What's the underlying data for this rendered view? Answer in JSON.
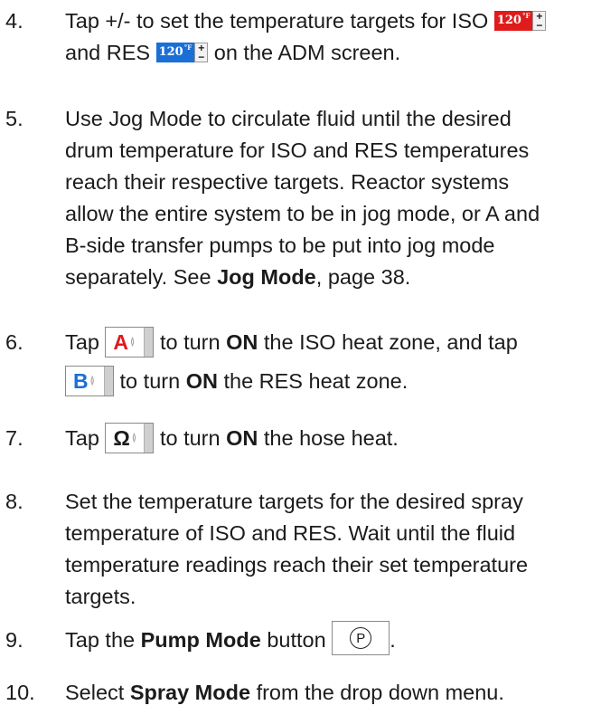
{
  "steps": [
    {
      "number": "4.",
      "text_a": "Tap +/- to set the temperature targets for ISO",
      "text_b": "and RES",
      "text_c": "on the ADM screen."
    },
    {
      "number": "5.",
      "lines": [
        "Use Jog Mode to circulate fluid until the desired",
        "drum temperature for ISO and RES temperatures",
        "reach their respective targets. Reactor systems",
        "allow the entire system to be in jog mode, or A and",
        "B-side transfer pumps to be put into jog mode"
      ],
      "last_pre": "separately. See ",
      "last_bold": "Jog Mode",
      "last_post": ", page 38."
    },
    {
      "number": "6.",
      "a1": "Tap",
      "a2": "to turn ",
      "a_on": "ON",
      "a3": " the ISO heat zone, and tap",
      "b2": "to turn ",
      "b_on": "ON",
      "b3": " the RES heat zone."
    },
    {
      "number": "7.",
      "a1": "Tap",
      "a2": "to turn ",
      "a_on": "ON",
      "a3": " the hose heat."
    },
    {
      "number": "8.",
      "lines": [
        "Set the temperature targets for the desired spray",
        "temperature of ISO and RES. Wait until the fluid",
        "temperature readings reach their set temperature",
        "targets."
      ]
    },
    {
      "number": "9.",
      "pre": "Tap the ",
      "bold": "Pump Mode",
      "post": " button",
      "end": "."
    },
    {
      "number": "10.",
      "pre": "Select ",
      "bold": "Spray Mode",
      "post": " from the drop down menu."
    }
  ],
  "widgets": {
    "iso_temp": {
      "value": "120",
      "unit": "°F",
      "plus": "+",
      "minus": "−",
      "color": "#e01b1b"
    },
    "res_temp": {
      "value": "120",
      "unit": "°F",
      "plus": "+",
      "minus": "−",
      "color": "#1a6fd6"
    },
    "zone_a": {
      "letter": "A",
      "flame": "≬",
      "color": "#e01b1b",
      "icon": "flame-icon"
    },
    "zone_b": {
      "letter": "B",
      "flame": "≬",
      "color": "#1a6fd6",
      "icon": "flame-icon"
    },
    "zone_hose": {
      "letter": "Ω",
      "flame": "≬",
      "color": "#1b1b1b",
      "icon": "flame-icon"
    },
    "pump_mode": {
      "glyph": "P",
      "icon": "pump-mode-icon"
    }
  }
}
